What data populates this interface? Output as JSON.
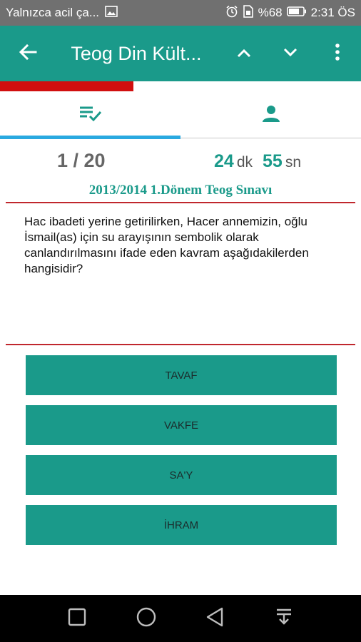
{
  "status_bar": {
    "notification_text": "Yalnızca acil ça...",
    "battery": "%68",
    "time": "2:31 ÖS",
    "icons": [
      "image-icon",
      "alarm-icon",
      "sim-icon",
      "battery-icon"
    ]
  },
  "app_bar": {
    "title": "Teog Din Kült...",
    "icons": [
      "back-arrow-icon",
      "chevron-up-icon",
      "chevron-down-icon",
      "overflow-menu-icon"
    ]
  },
  "progress": {
    "fraction": 0.37,
    "color": "#d10f0f"
  },
  "tabs": [
    {
      "icon": "checklist-icon",
      "active": true
    },
    {
      "icon": "person-icon",
      "active": false
    }
  ],
  "quiz": {
    "counter": "1 / 20",
    "timer": {
      "minutes": "24",
      "minutes_unit": "dk",
      "seconds": "55",
      "seconds_unit": "sn"
    },
    "exam_title": "2013/2014 1.Dönem Teog Sınavı",
    "question": "Hac ibadeti yerine getirilirken, Hacer annemizin, oğlu İsmail(as) için su arayışının sembolik olarak canlandırılmasını ifade eden kavram aşağıdakilerden hangisidir?",
    "answers": [
      "TAVAF",
      "VAKFE",
      "SA'Y",
      "İHRAM"
    ]
  },
  "nav_bar": {
    "icons": [
      "recents-square-icon",
      "home-circle-icon",
      "back-triangle-icon",
      "notification-pulldown-icon"
    ]
  },
  "colors": {
    "primary": "#1a9a8a",
    "accent_tab": "#2aa9e0",
    "divider": "#c0272d"
  }
}
